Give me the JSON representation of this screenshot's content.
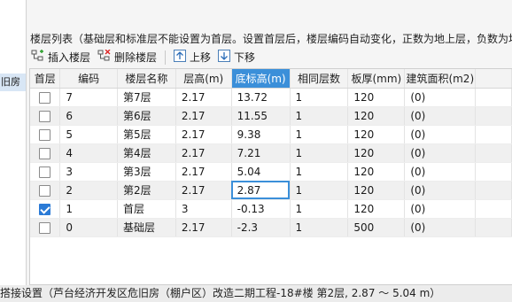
{
  "left_panel": {
    "selected_item": "旧房"
  },
  "caption": "楼层列表（基础层和标准层不能设置为首层。设置首层后，楼层编码自动变化，正数为地上层，负数为地",
  "toolbar": {
    "insert_label": "插入楼层",
    "delete_label": "删除楼层",
    "up_label": "上移",
    "down_label": "下移"
  },
  "table": {
    "headers": [
      "首层",
      "编码",
      "楼层名称",
      "层高(m)",
      "底标高(m)",
      "相同层数",
      "板厚(mm)",
      "建筑面积(m2)"
    ],
    "sorted_column": "底标高(m)",
    "rows": [
      {
        "first": false,
        "code": "7",
        "name": "第7层",
        "height": "2.17",
        "base": "13.72",
        "same": "1",
        "thick": "120",
        "area": "(0)"
      },
      {
        "first": false,
        "code": "6",
        "name": "第6层",
        "height": "2.17",
        "base": "11.55",
        "same": "1",
        "thick": "120",
        "area": "(0)"
      },
      {
        "first": false,
        "code": "5",
        "name": "第5层",
        "height": "2.17",
        "base": "9.38",
        "same": "1",
        "thick": "120",
        "area": "(0)"
      },
      {
        "first": false,
        "code": "4",
        "name": "第4层",
        "height": "2.17",
        "base": "7.21",
        "same": "1",
        "thick": "120",
        "area": "(0)"
      },
      {
        "first": false,
        "code": "3",
        "name": "第3层",
        "height": "2.17",
        "base": "5.04",
        "same": "1",
        "thick": "120",
        "area": "(0)"
      },
      {
        "first": false,
        "code": "2",
        "name": "第2层",
        "height": "2.17",
        "base": "2.87",
        "same": "1",
        "thick": "120",
        "area": "(0)"
      },
      {
        "first": true,
        "code": "1",
        "name": "首层",
        "height": "3",
        "base": "-0.13",
        "same": "1",
        "thick": "120",
        "area": "(0)"
      },
      {
        "first": false,
        "code": "0",
        "name": "基础层",
        "height": "2.17",
        "base": "-2.3",
        "same": "1",
        "thick": "500",
        "area": "(0)"
      }
    ],
    "editing_row": 5
  },
  "status_bar": "搭接设置（芦台经济开发区危旧房（棚户区）改造二期工程-18#楼  第2层, 2.87 ～ 5.04 m）",
  "colors": {
    "accent": "#3b8fd9",
    "checkbox_on": "#2a7ad6"
  }
}
